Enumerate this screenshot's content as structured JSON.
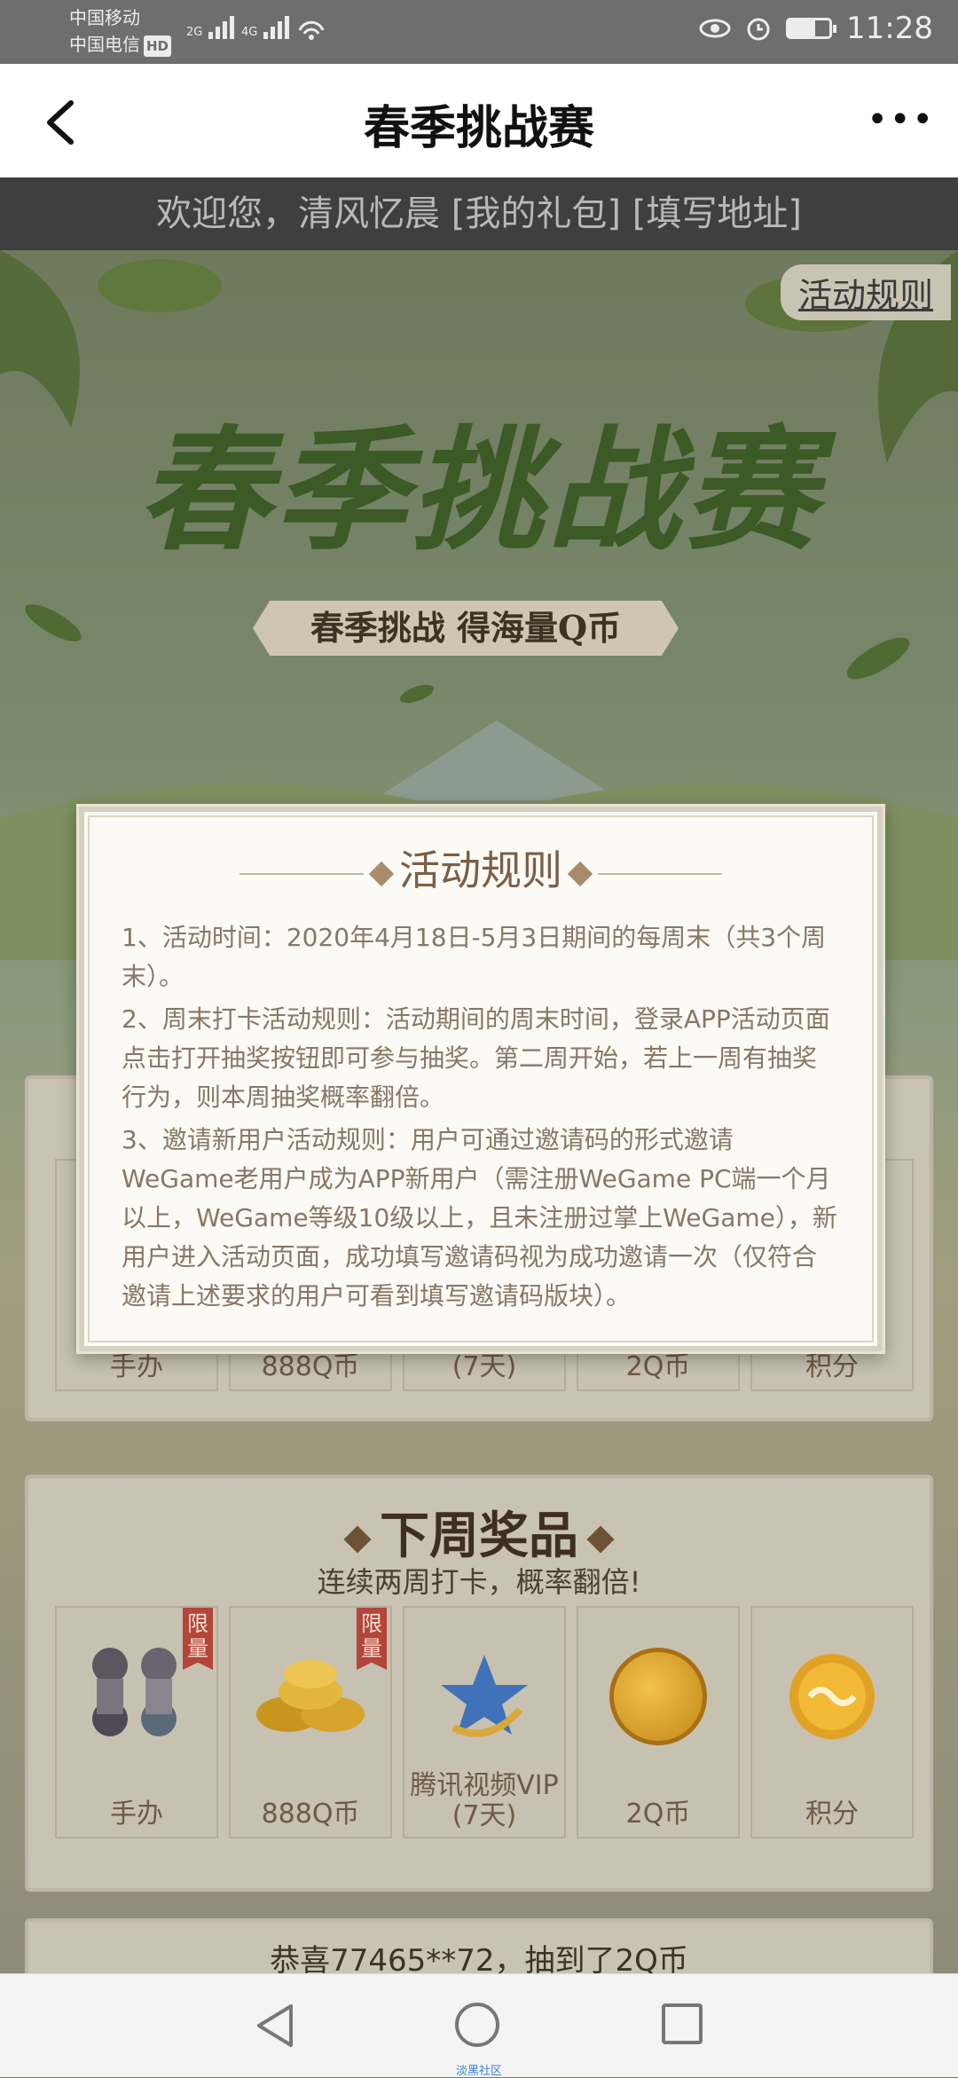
{
  "status_bar": {
    "carrier1": "中国移动",
    "carrier2": "中国电信",
    "hd_badge": "HD",
    "network1": "2G",
    "network2": "4G",
    "time": "11:28",
    "battery_level": 0.65
  },
  "navbar": {
    "title": "春季挑战赛",
    "more": "•••"
  },
  "welcome": {
    "prefix": "欢迎您，清风忆晨 ",
    "gift_link": "[我的礼包]",
    "address_link": " [填写地址]"
  },
  "hero": {
    "rules_link": "活动规则",
    "title": "春季挑战赛",
    "subtitle": "春季挑战 得海量Q币"
  },
  "this_week": {
    "prizes": [
      {
        "label": "手办"
      },
      {
        "label": "888Q币"
      },
      {
        "label": "腾讯视频VIP (7天)"
      },
      {
        "label": "2Q币"
      },
      {
        "label": "积分"
      }
    ]
  },
  "next_week": {
    "title": "下周奖品",
    "subtitle": "连续两周打卡，概率翻倍!",
    "limit_badge": "限量",
    "prizes": [
      {
        "label": "手办"
      },
      {
        "label": "888Q币"
      },
      {
        "label": "腾讯视频VIP",
        "sub": "(7天)"
      },
      {
        "label": "2Q币"
      },
      {
        "label": "积分"
      }
    ]
  },
  "ticker": {
    "line1": "恭喜77465**72，抽到了2Q币"
  },
  "modal": {
    "title": "活动规则",
    "rule1": "1、活动时间：2020年4月18日-5月3日期间的每周末（共3个周末）。",
    "rule2": "2、周末打卡活动规则：活动期间的周末时间，登录APP活动页面点击打开抽奖按钮即可参与抽奖。第二周开始，若上一周有抽奖行为，则本周抽奖概率翻倍。",
    "rule3": "3、邀请新用户活动规则：用户可通过邀请码的形式邀请WeGame老用户成为APP新用户（需注册WeGame PC端一个月以上，WeGame等级10级以上，且未注册过掌上WeGame），新用户进入活动页面，成功填写邀请码视为成功邀请一次（仅符合邀请上述要求的用户可看到填写邀请码版块）。"
  },
  "bottom_nav": {
    "label": "淡黑社区"
  }
}
